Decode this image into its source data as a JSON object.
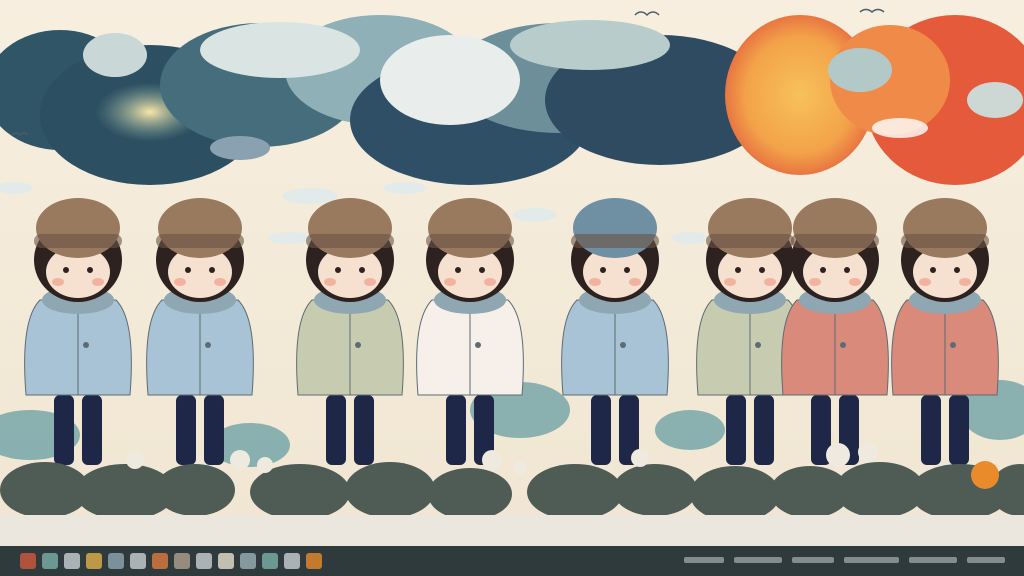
{
  "palette": {
    "sky": "#f4ead6",
    "cloud_dark": "#3d5f6e",
    "cloud_mid": "#8fb0b6",
    "sunset_orange": "#f3a34a",
    "sunset_red": "#e0553c",
    "ground_rock": "#4f5c55",
    "coat_blue": "#a8c3d6",
    "coat_sage": "#c7ccb1",
    "coat_white": "#f7efe9",
    "coat_pink": "#d98a7a",
    "hat_brown": "#9a7a5f",
    "hat_blue": "#6f8fa3",
    "pants_navy": "#1f2748",
    "hair_dark": "#2e2220",
    "skin": "#f6e1d1"
  },
  "characters": [
    {
      "id": 1,
      "coat": "coat_blue",
      "hat": "hat_brown"
    },
    {
      "id": 2,
      "coat": "coat_blue",
      "hat": "hat_brown"
    },
    {
      "id": 3,
      "coat": "coat_sage",
      "hat": "hat_brown"
    },
    {
      "id": 4,
      "coat": "coat_white",
      "hat": "hat_brown"
    },
    {
      "id": 5,
      "coat": "coat_blue",
      "hat": "hat_blue"
    },
    {
      "id": 6,
      "coat": "coat_sage",
      "hat": "hat_brown"
    },
    {
      "id": 7,
      "coat": "coat_pink",
      "hat": "hat_brown"
    },
    {
      "id": 8,
      "coat": "coat_pink",
      "hat": "hat_brown"
    }
  ],
  "toolbar_icons": [
    "flower-icon",
    "leaf-icon",
    "bird-icon",
    "cup-icon",
    "plant-icon",
    "fish-icon",
    "flame-icon",
    "bottle-icon",
    "fan-icon",
    "spark-icon",
    "wheel-icon",
    "tree-icon",
    "cloud-icon",
    "ornament-icon"
  ]
}
